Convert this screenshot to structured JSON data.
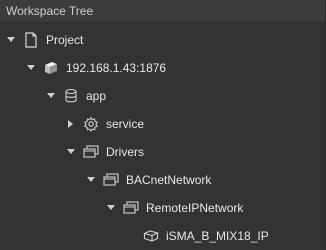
{
  "panel": {
    "title": "Workspace Tree"
  },
  "tree": [
    {
      "label": "Project",
      "icon": "document-icon",
      "expanded": true
    },
    {
      "label": "192.168.1.43:1876",
      "icon": "server-cube-icon",
      "expanded": true
    },
    {
      "label": "app",
      "icon": "database-icon",
      "expanded": true
    },
    {
      "label": "service",
      "icon": "gear-icon",
      "expanded": false
    },
    {
      "label": "Drivers",
      "icon": "stacked-windows-icon",
      "expanded": true
    },
    {
      "label": "BACnetNetwork",
      "icon": "stacked-windows-icon",
      "expanded": true
    },
    {
      "label": "RemoteIPNetwork",
      "icon": "stacked-windows-icon",
      "expanded": true
    },
    {
      "label": "iSMA_B_MIX18_IP",
      "icon": "device-box-icon",
      "expanded": null
    }
  ]
}
